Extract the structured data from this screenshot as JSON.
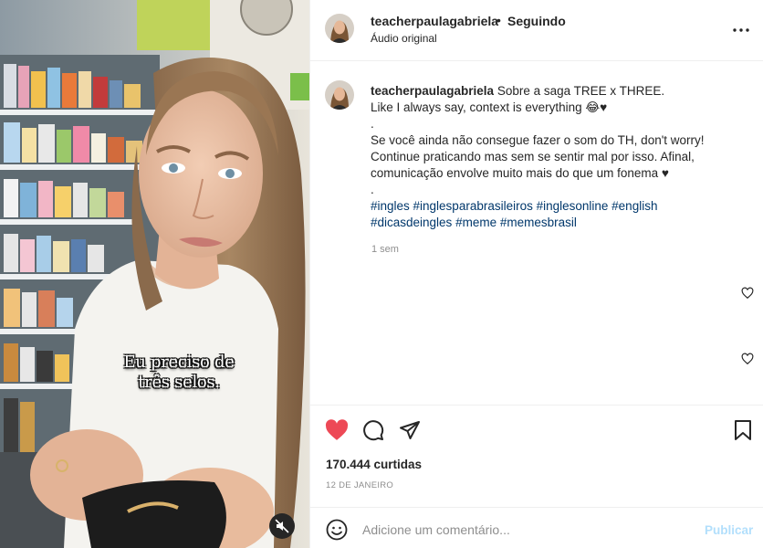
{
  "post": {
    "username": "teacherpaulagabriela",
    "follow_separator": "•",
    "follow_status": "Seguindo",
    "audio_label": "Áudio original"
  },
  "video": {
    "subtitle_line1": "Eu preciso de",
    "subtitle_line2": "três selos."
  },
  "caption": {
    "username": "teacherpaulagabriela",
    "line1": "Sobre a saga TREE x THREE.",
    "line2": "Like I always say, context is everything 😂♥",
    "sep1": ".",
    "line3": "Se você ainda não consegue fazer o som do TH, don't worry!",
    "line4": "Continue praticando mas sem se sentir mal por isso. Afinal,",
    "line5": "comunicação envolve muito mais do que um fonema ♥",
    "sep2": ".",
    "hashtags_line1": "#ingles #inglesparabrasileiros #inglesonline #english",
    "hashtags_line2": "#dicasdeingles #meme #memesbrasil",
    "time_ago": "1 sem"
  },
  "stats": {
    "likes": "170.444 curtidas",
    "date": "12 DE JANEIRO"
  },
  "comment_box": {
    "placeholder": "Adicione um comentário...",
    "publish_label": "Publicar"
  },
  "icons": {
    "like": "heart-filled-icon",
    "comment": "comment-icon",
    "share": "paper-plane-icon",
    "save": "bookmark-icon",
    "emoji": "smiley-icon",
    "mute": "speaker-muted-icon",
    "more": "more-options-icon"
  },
  "colors": {
    "like_red": "#ed4956",
    "hashtag_blue": "#00376b",
    "publish_disabled": "#b2dffc",
    "muted_text": "#8e8e8e"
  }
}
